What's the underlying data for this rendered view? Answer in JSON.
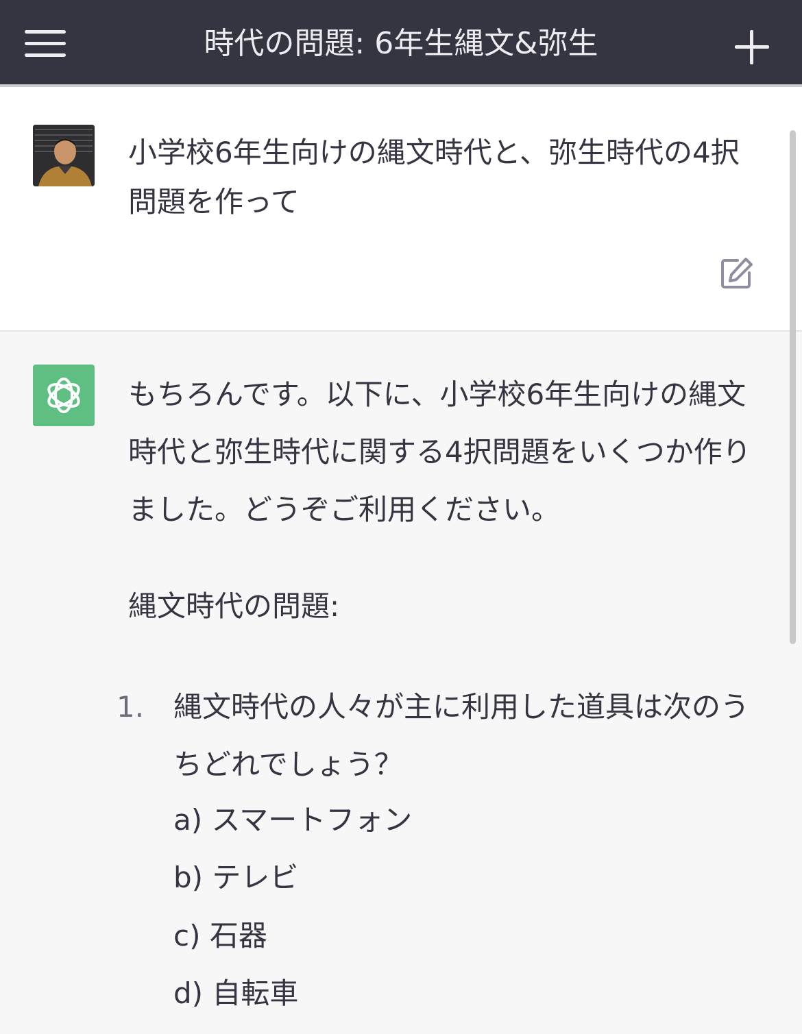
{
  "header": {
    "title": "時代の問題: 6年生縄文&弥生",
    "menu_icon": "hamburger-menu-icon",
    "new_chat_icon": "plus-icon"
  },
  "user_message": {
    "text": "小学校6年生向けの縄文時代と、弥生時代の4択問題を作って",
    "edit_icon": "edit-icon"
  },
  "assistant_message": {
    "intro": "もちろんです。以下に、小学校6年生向けの縄文時代と弥生時代に関する4択問題をいくつか作りました。どうぞご利用ください。",
    "section_title": "縄文時代の問題:",
    "question_number": "1.",
    "question_text": "縄文時代の人々が主に利用した道具は次のうちどれでしょう？",
    "options": [
      "a) スマートフォン",
      "b) テレビ",
      "c) 石器",
      "d) 自転車"
    ]
  },
  "colors": {
    "header_bg": "#343541",
    "header_text": "#ececf1",
    "assistant_bg": "#f7f7f8",
    "gpt_logo_bg": "#5fbf83"
  }
}
